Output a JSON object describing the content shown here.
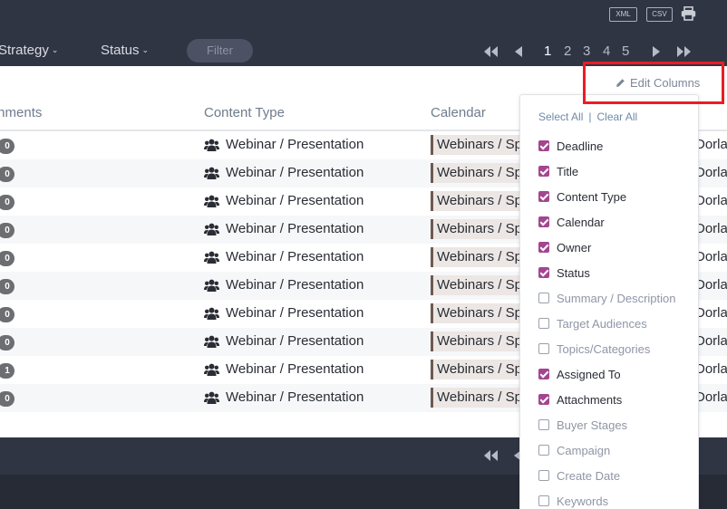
{
  "toolbar": {
    "export_xml": "XML",
    "export_csv": "CSV",
    "print_icon": "print-icon"
  },
  "filters": {
    "strategy_label": "Strategy",
    "status_label": "Status",
    "filter_placeholder": "Filter"
  },
  "pagination": {
    "pages": [
      "1",
      "2",
      "3",
      "4",
      "5"
    ],
    "current_page": "1"
  },
  "columns": {
    "attachments": "Attachments",
    "content_type": "Content Type",
    "calendar": "Calendar"
  },
  "rows": [
    {
      "attachments": "0",
      "content_type": "Webinar / Presentation",
      "calendar": "Webinars / Sponsorships",
      "owner": "Dorla"
    },
    {
      "attachments": "0",
      "content_type": "Webinar / Presentation",
      "calendar": "Webinars / Sponsorships",
      "owner": "Dorla"
    },
    {
      "attachments": "0",
      "content_type": "Webinar / Presentation",
      "calendar": "Webinars / Sponsorships",
      "owner": "Dorla"
    },
    {
      "attachments": "0",
      "content_type": "Webinar / Presentation",
      "calendar": "Webinars / Sponsorships",
      "owner": "Dorla"
    },
    {
      "attachments": "0",
      "content_type": "Webinar / Presentation",
      "calendar": "Webinars / Sponsorships",
      "owner": "Dorla"
    },
    {
      "attachments": "0",
      "content_type": "Webinar / Presentation",
      "calendar": "Webinars / Sponsorships",
      "owner": "Dorla"
    },
    {
      "attachments": "0",
      "content_type": "Webinar / Presentation",
      "calendar": "Webinars / Sponsorships",
      "owner": "Dorla"
    },
    {
      "attachments": "0",
      "content_type": "Webinar / Presentation",
      "calendar": "Webinars / Sponsorships",
      "owner": "Dorla"
    },
    {
      "attachments": "1",
      "content_type": "Webinar / Presentation",
      "calendar": "Webinars / Sponsorships",
      "owner": "Dorla"
    },
    {
      "attachments": "0",
      "content_type": "Webinar / Presentation",
      "calendar": "Webinars / Sponsorships",
      "owner": "Dorla"
    }
  ],
  "edit_columns": {
    "label": "Edit Columns",
    "icon": "pencil-icon",
    "select_all": "Select All",
    "separator": "|",
    "clear_all": "Clear All",
    "options": [
      {
        "label": "Deadline",
        "checked": true
      },
      {
        "label": "Title",
        "checked": true
      },
      {
        "label": "Content Type",
        "checked": true
      },
      {
        "label": "Calendar",
        "checked": true
      },
      {
        "label": "Owner",
        "checked": true
      },
      {
        "label": "Status",
        "checked": true
      },
      {
        "label": "Summary / Description",
        "checked": false
      },
      {
        "label": "Target Audiences",
        "checked": false
      },
      {
        "label": "Topics/Categories",
        "checked": false
      },
      {
        "label": "Assigned To",
        "checked": true
      },
      {
        "label": "Attachments",
        "checked": true
      },
      {
        "label": "Buyer Stages",
        "checked": false
      },
      {
        "label": "Campaign",
        "checked": false
      },
      {
        "label": "Create Date",
        "checked": false
      },
      {
        "label": "Keywords",
        "checked": false
      }
    ]
  },
  "colors": {
    "topbar": "#303544",
    "checkbox_accent": "#a3468f",
    "highlight": "#ec1c24",
    "calendar_tag_bg": "#ece7e4"
  }
}
